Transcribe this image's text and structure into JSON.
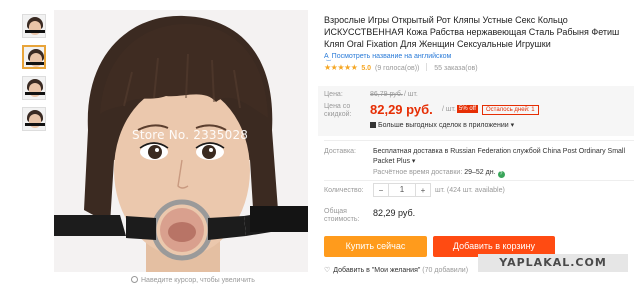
{
  "gallery": {
    "thumbnail_count": 4,
    "active_index": 1,
    "watermark": "Store No. 2335028",
    "zoom_hint": "Наведите курсор, чтобы увеличить"
  },
  "product": {
    "title": "Взрослые Игры Открытый Рот Кляпы Устные Секс Кольцо ИСКУССТВЕННАЯ Кожа Рабства нержавеющая Сталь Рабыня Фетиш Кляп Oral Fixation Для Женщин Сексуальные Игрушки",
    "translate_link": "Посмотреть название на английском",
    "stars": "★★★★★",
    "rating": "5.0",
    "votes": "(9 голоса(ов))",
    "orders": "55 заказа(ов)"
  },
  "pricing": {
    "price_label": "Цена:",
    "old_price": "86,79 руб.",
    "old_unit": "/ шт.",
    "discount_label_line1": "Цена со",
    "discount_label_line2": "скидкой:",
    "new_price": "82,29 руб.",
    "new_unit": "/ шт.",
    "discount_badge": "5% off",
    "days_left": "Осталось дней: 1",
    "app_deals": "Больше выгодных сделок в приложении ▾"
  },
  "shipping": {
    "label": "Доставка:",
    "text": "Бесплатная доставка в Russian Federation службой China Post Ordinary Small Packet Plus ▾",
    "eta_label": "Расчётное время доставки:",
    "eta_value": "29–52 дн.",
    "info_icon_text": "?"
  },
  "quantity": {
    "label": "Количество:",
    "minus": "−",
    "value": "1",
    "plus": "+",
    "available": "шт. (424 шт. available)"
  },
  "total": {
    "label_line1": "Общая",
    "label_line2": "стоимость:",
    "value": "82,29 руб."
  },
  "actions": {
    "buy_now": "Купить сейчас",
    "add_to_cart": "Добавить в корзину",
    "wishlist": "Добавить в \"Мои желания\"",
    "wishlist_count": "(70 добавили)",
    "heart_icon": "♡"
  },
  "overlay": {
    "site_watermark": "YAPLAKAL.COM"
  },
  "colors": {
    "price_red": "#e62e04",
    "buy_orange": "#ff9b1c",
    "cart_red": "#ff4b12",
    "star_gold": "#f5a623",
    "link_blue": "#2a7bd8"
  }
}
